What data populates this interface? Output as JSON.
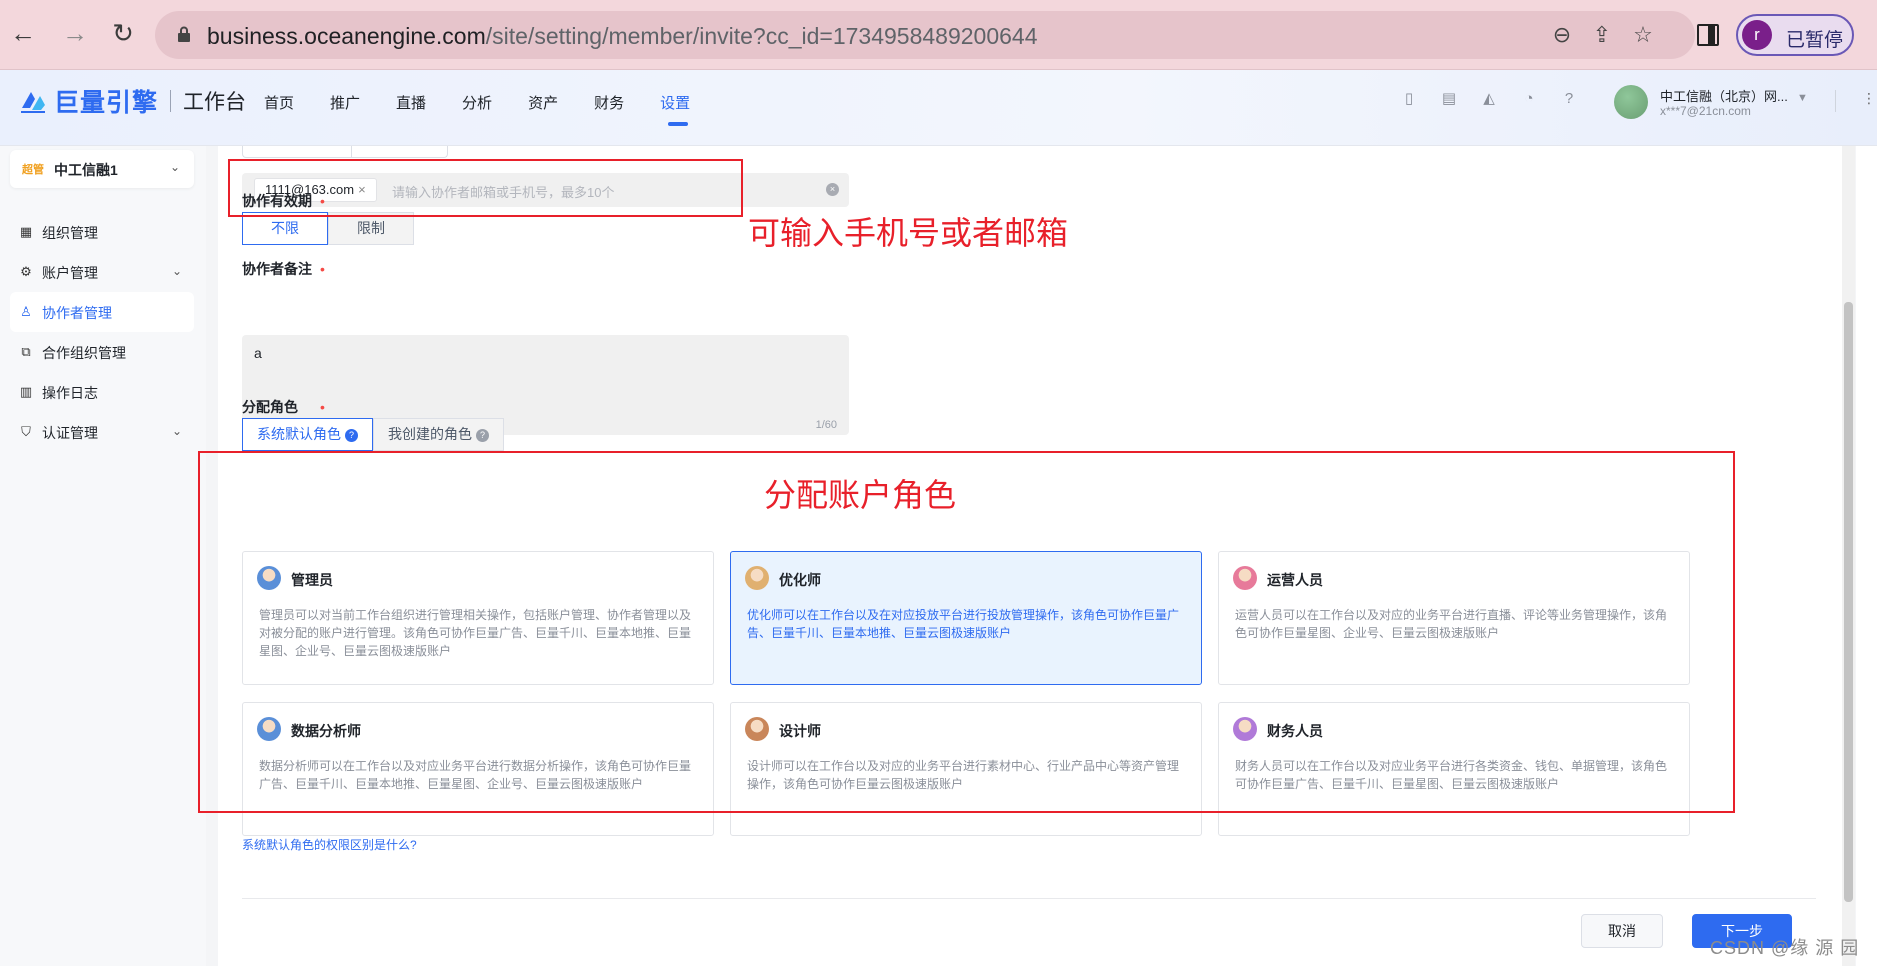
{
  "browser": {
    "url_host": "business.oceanengine.com",
    "url_path": "/site/setting/member/invite?cc_id=1734958489200644",
    "profile_initial": "r",
    "profile_label": "已暂停"
  },
  "header": {
    "brand": "巨量引擎",
    "workspace": "工作台",
    "nav": [
      "首页",
      "推广",
      "直播",
      "分析",
      "资产",
      "财务",
      "设置"
    ],
    "active_nav": "设置",
    "user_name": "中工信融（北京）网...",
    "user_email": "x***7@21cn.com"
  },
  "sidebar": {
    "tenant_tag": "超管",
    "tenant_name": "中工信融1",
    "items": [
      {
        "label": "组织管理",
        "icon": "grid-icon"
      },
      {
        "label": "账户管理",
        "icon": "gear-icon"
      },
      {
        "label": "协作者管理",
        "icon": "user-icon"
      },
      {
        "label": "合作组织管理",
        "icon": "copy-icon"
      },
      {
        "label": "操作日志",
        "icon": "log-icon"
      },
      {
        "label": "认证管理",
        "icon": "shield-icon"
      }
    ],
    "active_item": "协作者管理"
  },
  "form": {
    "collaborator_chip": "1111@163.com",
    "collaborator_placeholder": "请输入协作者邮箱或手机号，最多10个",
    "validity_label": "协作有效期",
    "validity_options": [
      "不限",
      "限制"
    ],
    "validity_selected": "不限",
    "note_label": "协作者备注",
    "note_value": "a",
    "note_count": "1/60",
    "role_label": "分配角色",
    "role_tabs": [
      "系统默认角色",
      "我创建的角色"
    ],
    "role_tab_selected": "系统默认角色",
    "roles": [
      {
        "name": "管理员",
        "desc": "管理员可以对当前工作台组织进行管理相关操作，包括账户管理、协作者管理以及对被分配的账户进行管理。该角色可协作巨量广告、巨量千川、巨量本地推、巨量星图、企业号、巨量云图极速版账户",
        "selected": false,
        "color": "#5a8fd8"
      },
      {
        "name": "优化师",
        "desc": "优化师可以在工作台以及在对应投放平台进行投放管理操作，该角色可协作巨量广告、巨量千川、巨量本地推、巨量云图极速版账户",
        "selected": true,
        "color": "#e0b070"
      },
      {
        "name": "运营人员",
        "desc": "运营人员可以在工作台以及对应的业务平台进行直播、评论等业务管理操作，该角色可协作巨量星图、企业号、巨量云图极速版账户",
        "selected": false,
        "color": "#e77a9a"
      },
      {
        "name": "数据分析师",
        "desc": "数据分析师可以在工作台以及对应业务平台进行数据分析操作，该角色可协作巨量广告、巨量千川、巨量本地推、巨量星图、企业号、巨量云图极速版账户",
        "selected": false,
        "color": "#5a8fd8"
      },
      {
        "name": "设计师",
        "desc": "设计师可以在工作台以及对应的业务平台进行素材中心、行业产品中心等资产管理操作，该角色可协作巨量云图极速版账户",
        "selected": false,
        "color": "#c9865a"
      },
      {
        "name": "财务人员",
        "desc": "财务人员可以在工作台以及对应业务平台进行各类资金、钱包、单据管理，该角色可协作巨量广告、巨量千川、巨量星图、巨量云图极速版账户",
        "selected": false,
        "color": "#b07ad8"
      }
    ],
    "help_link": "系统默认角色的权限区别是什么?",
    "cancel_label": "取消",
    "next_label": "下一步"
  },
  "annotations": {
    "input_note": "可输入手机号或者邮箱",
    "role_note": "分配账户角色",
    "color": "#e8202a"
  },
  "watermark": "CSDN @缘 源 园"
}
